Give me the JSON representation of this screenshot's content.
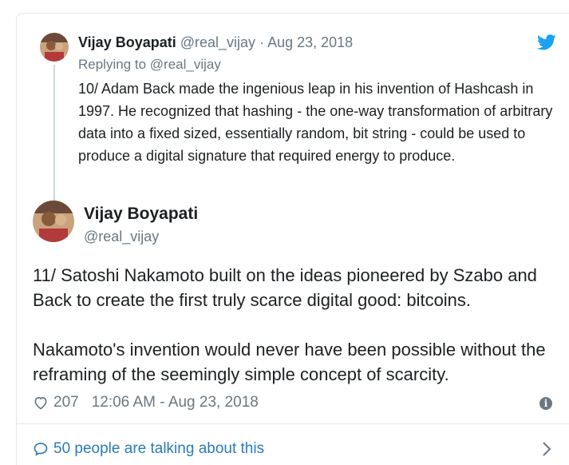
{
  "parent_tweet": {
    "name": "Vijay Boyapati",
    "handle": "@real_vijay",
    "separator": "·",
    "date": "Aug 23, 2018",
    "replying_to": "Replying to @real_vijay",
    "text": "10/ Adam Back made the ingenious leap in his invention of Hashcash in 1997. He recognized that hashing - the one-way transformation of arbitrary data into a fixed sized, essentially random, bit string - could be used to produce a digital signature that required energy to produce."
  },
  "main_tweet": {
    "name": "Vijay Boyapati",
    "handle": "@real_vijay",
    "paragraph_1": "11/ Satoshi Nakamoto built on the ideas pioneered by Szabo and Back to create the first truly scarce digital good: bitcoins.",
    "paragraph_2": "Nakamoto's invention would never have been possible without the reframing of the seemingly simple concept of scarcity.",
    "likes": "207",
    "timestamp": "12:06 AM - Aug 23, 2018"
  },
  "footer": {
    "talking_label": "50 people are talking about this"
  },
  "icons": {
    "brand": "twitter-bird-icon",
    "like": "heart-icon",
    "info": "info-icon",
    "conversation": "chat-bubble-icon",
    "more": "chevron-right-icon"
  },
  "colors": {
    "twitter_blue": "#1da1f2",
    "link_blue": "#2b7bb9",
    "secondary_text": "#697882",
    "border": "#e1e8ed"
  }
}
